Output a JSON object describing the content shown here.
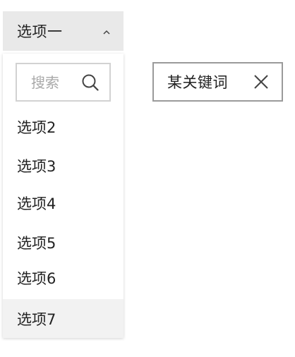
{
  "dropdown": {
    "selected_label": "选项一",
    "search_placeholder": "搜索",
    "search_value": "",
    "options": [
      {
        "label": "选项2"
      },
      {
        "label": "选项3"
      },
      {
        "label": "选项4"
      },
      {
        "label": "选项5"
      },
      {
        "label": "选项6"
      },
      {
        "label": "选项7",
        "hovered": true
      }
    ],
    "chevron_icon": "chevron-up-icon",
    "search_icon": "search-icon"
  },
  "tag": {
    "label": "某关键词",
    "close_icon": "close-icon"
  },
  "colors": {
    "trigger_background": "#e9e9e9",
    "hover_background": "#f2f2f2",
    "text": "#222222",
    "placeholder": "#a9a9a9",
    "input_border": "#d2d2d2",
    "tag_border": "#9a9a9a"
  }
}
